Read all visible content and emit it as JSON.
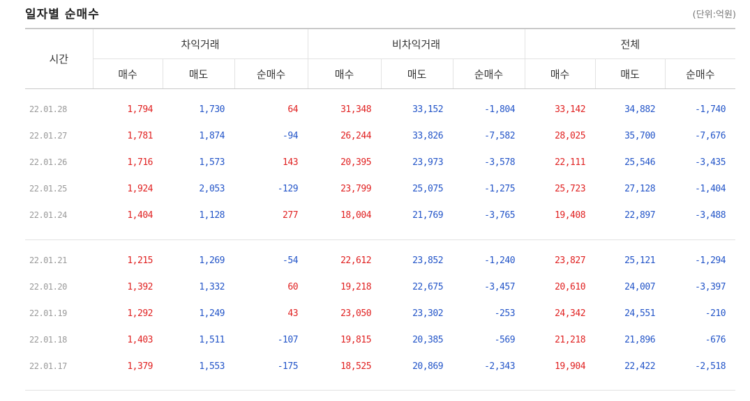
{
  "header": {
    "title": "일자별 순매수",
    "unit": "(단위:억원)"
  },
  "columns": {
    "time": "시간",
    "groups": [
      "차익거래",
      "비차익거래",
      "전체"
    ],
    "sub": [
      "매수",
      "매도",
      "순매수"
    ]
  },
  "rows": [
    [
      "22.01.28",
      "1,794",
      "1,730",
      "64",
      "31,348",
      "33,152",
      "-1,804",
      "33,142",
      "34,882",
      "-1,740"
    ],
    [
      "22.01.27",
      "1,781",
      "1,874",
      "-94",
      "26,244",
      "33,826",
      "-7,582",
      "28,025",
      "35,700",
      "-7,676"
    ],
    [
      "22.01.26",
      "1,716",
      "1,573",
      "143",
      "20,395",
      "23,973",
      "-3,578",
      "22,111",
      "25,546",
      "-3,435"
    ],
    [
      "22.01.25",
      "1,924",
      "2,053",
      "-129",
      "23,799",
      "25,075",
      "-1,275",
      "25,723",
      "27,128",
      "-1,404"
    ],
    [
      "22.01.24",
      "1,404",
      "1,128",
      "277",
      "18,004",
      "21,769",
      "-3,765",
      "19,408",
      "22,897",
      "-3,488"
    ],
    [
      "22.01.21",
      "1,215",
      "1,269",
      "-54",
      "22,612",
      "23,852",
      "-1,240",
      "23,827",
      "25,121",
      "-1,294"
    ],
    [
      "22.01.20",
      "1,392",
      "1,332",
      "60",
      "19,218",
      "22,675",
      "-3,457",
      "20,610",
      "24,007",
      "-3,397"
    ],
    [
      "22.01.19",
      "1,292",
      "1,249",
      "43",
      "23,050",
      "23,302",
      "-253",
      "24,342",
      "24,551",
      "-210"
    ],
    [
      "22.01.18",
      "1,403",
      "1,511",
      "-107",
      "19,815",
      "20,385",
      "-569",
      "21,218",
      "21,896",
      "-676"
    ],
    [
      "22.01.17",
      "1,379",
      "1,553",
      "-175",
      "18,525",
      "20,869",
      "-2,343",
      "19,904",
      "22,422",
      "-2,518"
    ]
  ],
  "colors": {
    "buy": "#e02020",
    "sell": "#2254c8",
    "date": "#999999"
  }
}
